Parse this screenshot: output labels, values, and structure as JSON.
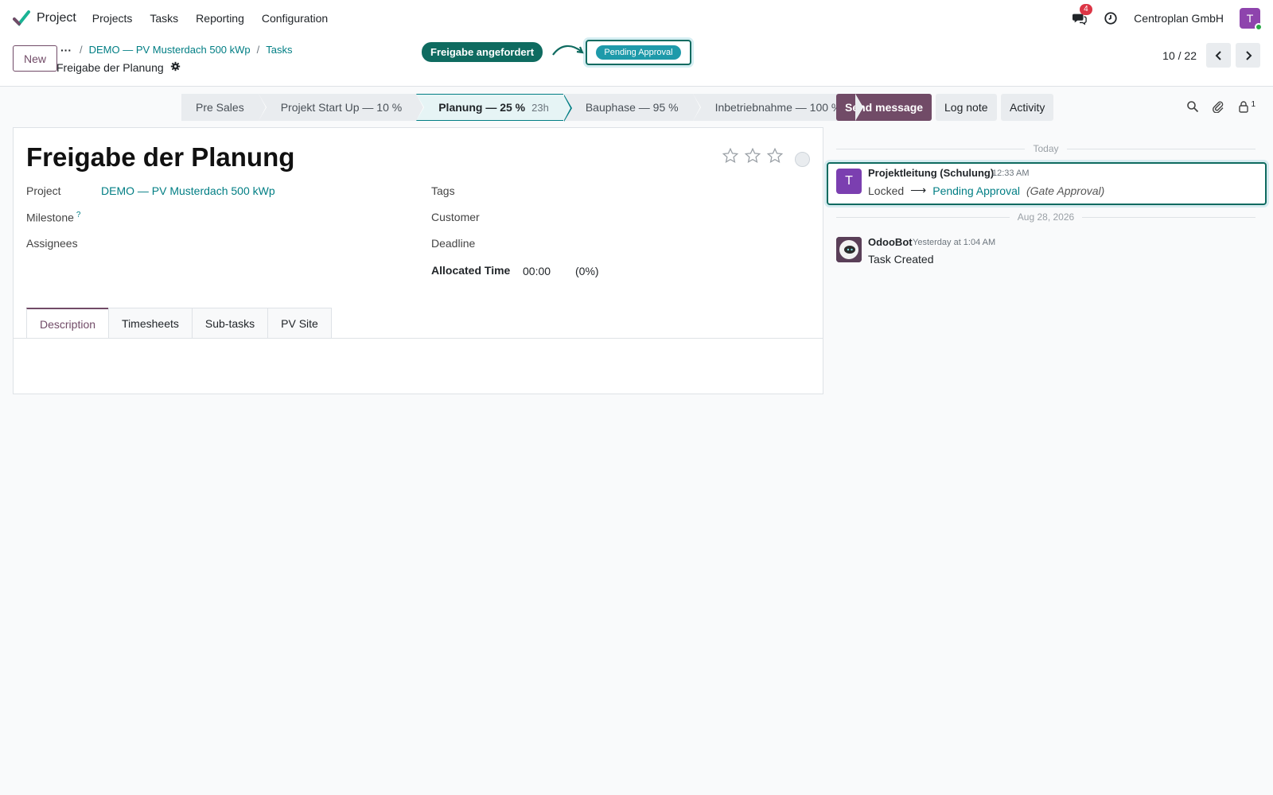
{
  "navbar": {
    "app_name": "Project",
    "menu": [
      "Projects",
      "Tasks",
      "Reporting",
      "Configuration"
    ],
    "messages_badge": "4",
    "company": "Centroplan GmbH",
    "user_initial": "T"
  },
  "control": {
    "new_label": "New",
    "more_label": "···",
    "breadcrumb": [
      "DEMO — PV Musterdach 500 kWp",
      "Tasks"
    ],
    "separator": "/",
    "record_title": "Freigabe der Planung",
    "annotation_pill": "Freigabe angefordert",
    "pending_status": "Pending Approval",
    "pager": "10 / 22"
  },
  "statusbar": {
    "stages": [
      {
        "label": "Pre Sales",
        "hours": ""
      },
      {
        "label": "Projekt Start Up — 10 %",
        "hours": ""
      },
      {
        "label": "Planung — 25 %",
        "hours": "23h"
      },
      {
        "label": "Bauphase — 95 %",
        "hours": ""
      },
      {
        "label": "Inbetriebnahme — 100 %",
        "hours": ""
      }
    ],
    "active_index": 2
  },
  "form": {
    "title": "Freigabe der Planung",
    "priority_stars": 3,
    "priority_value": 0,
    "fields_left": [
      {
        "label": "Project",
        "value": "DEMO — PV Musterdach 500 kWp"
      },
      {
        "label": "Milestone",
        "help": "?",
        "value": ""
      },
      {
        "label": "Assignees",
        "value": ""
      }
    ],
    "fields_right": [
      {
        "label": "Tags",
        "value": ""
      },
      {
        "label": "Customer",
        "value": ""
      },
      {
        "label": "Deadline",
        "value": ""
      },
      {
        "label": "Allocated Time",
        "value": "00:00",
        "extra": "(0%)"
      }
    ],
    "tabs": [
      "Description",
      "Timesheets",
      "Sub-tasks",
      "PV Site"
    ],
    "active_tab": 0
  },
  "chatter": {
    "send_message": "Send message",
    "log_note": "Log note",
    "activity": "Activity",
    "followers_count": "1",
    "sep_today": "Today",
    "sep_date": "Aug 28, 2026",
    "messages": [
      {
        "avatar_initial": "T",
        "author": "Projektleitung (Schulung)",
        "time": "12:33 AM",
        "old_value": "Locked",
        "arrow": "⟶",
        "new_value": "Pending Approval",
        "field": "(Gate Approval)"
      },
      {
        "author": "OdooBot",
        "time": "Yesterday at 1:04 AM",
        "body": "Task Created"
      }
    ]
  },
  "colors": {
    "brand": "#714b67",
    "link": "#017e84",
    "annotation": "#0f6b60",
    "pending": "#1e9aaa"
  }
}
